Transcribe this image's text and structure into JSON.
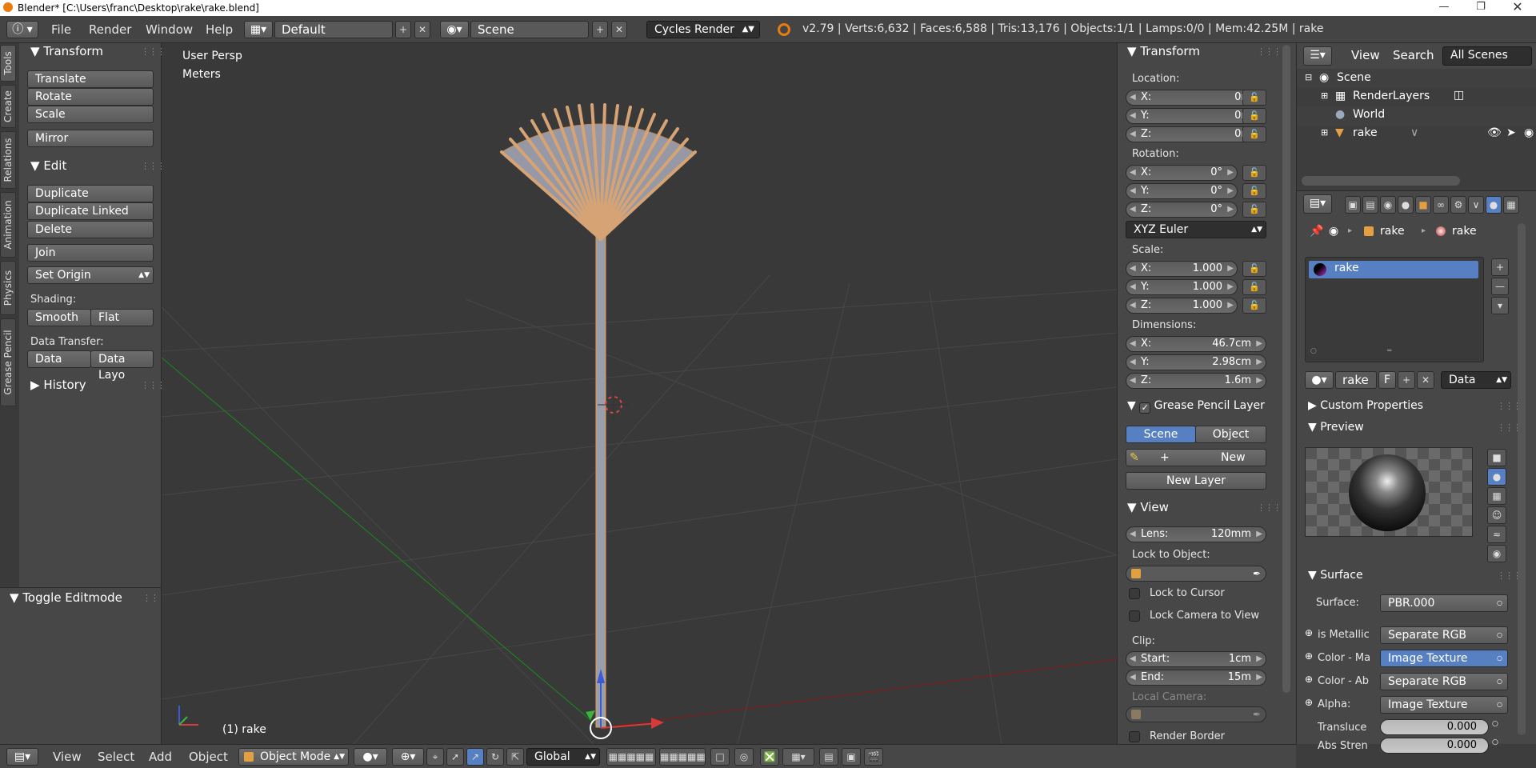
{
  "titlebar": {
    "title": "Blender* [C:\\Users\\franc\\Desktop\\rake\\rake.blend]"
  },
  "info": {
    "menus": [
      "File",
      "Render",
      "Window",
      "Help"
    ],
    "layout": "Default",
    "scene": "Scene",
    "engine": "Cycles Render",
    "stats": "v2.79 | Verts:6,632 | Faces:6,588 | Tris:13,176 | Objects:1/1 | Lamps:0/0 | Mem:42.25M | rake"
  },
  "tool_tabs": [
    "Tools",
    "Create",
    "Relations",
    "Animation",
    "Physics",
    "Grease Pencil"
  ],
  "tools": {
    "transform_header": "Transform",
    "translate": "Translate",
    "rotate": "Rotate",
    "scale": "Scale",
    "mirror": "Mirror",
    "edit_header": "Edit",
    "duplicate": "Duplicate",
    "duplicate_linked": "Duplicate Linked",
    "delete": "Delete",
    "join": "Join",
    "set_origin": "Set Origin",
    "shading_label": "Shading:",
    "smooth": "Smooth",
    "flat": "Flat",
    "data_transfer_label": "Data Transfer:",
    "data": "Data",
    "data_layo": "Data Layo",
    "history_header": "History",
    "toggle_editmode": "Toggle Editmode"
  },
  "viewport": {
    "view_name": "User Persp",
    "units": "Meters",
    "object_label": "(1) rake"
  },
  "properties": {
    "transform_header": "Transform",
    "location_label": "Location:",
    "location": [
      {
        "k": "X:",
        "v": "0m"
      },
      {
        "k": "Y:",
        "v": "0m"
      },
      {
        "k": "Z:",
        "v": "0m"
      }
    ],
    "rotation_label": "Rotation:",
    "rotation": [
      {
        "k": "X:",
        "v": "0°"
      },
      {
        "k": "Y:",
        "v": "0°"
      },
      {
        "k": "Z:",
        "v": "0°"
      }
    ],
    "rotation_mode": "XYZ Euler",
    "scale_label": "Scale:",
    "scale": [
      {
        "k": "X:",
        "v": "1.000"
      },
      {
        "k": "Y:",
        "v": "1.000"
      },
      {
        "k": "Z:",
        "v": "1.000"
      }
    ],
    "dimensions_label": "Dimensions:",
    "dimensions": [
      {
        "k": "X:",
        "v": "46.7cm"
      },
      {
        "k": "Y:",
        "v": "2.98cm"
      },
      {
        "k": "Z:",
        "v": "1.6m"
      }
    ],
    "gp_header": "Grease Pencil Layer",
    "gp_scene": "Scene",
    "gp_object": "Object",
    "gp_new": "New",
    "gp_new_layer": "New Layer",
    "view_header": "View",
    "lens_label": "Lens:",
    "lens_value": "120mm",
    "lock_to_object_label": "Lock to Object:",
    "lock_to_cursor": "Lock to Cursor",
    "lock_camera_to_view": "Lock Camera to View",
    "clip_label": "Clip:",
    "clip_start_label": "Start:",
    "clip_start": "1cm",
    "clip_end_label": "End:",
    "clip_end": "15m",
    "local_camera_label": "Local Camera:",
    "render_border": "Render Border"
  },
  "outliner": {
    "view": "View",
    "search": "Search",
    "filter": "All Scenes",
    "items": [
      "Scene",
      "RenderLayers",
      "World",
      "rake"
    ]
  },
  "material": {
    "breadcrumb_obj": "rake",
    "breadcrumb_mat": "rake",
    "slot": "rake",
    "mat_name": "rake",
    "fake_user": "F",
    "link_mode": "Data",
    "custom_props": "Custom Properties",
    "preview": "Preview",
    "surface_header": "Surface",
    "surface_label": "Surface:",
    "surface_value": "PBR.000",
    "inputs": [
      {
        "label": "is Metallic",
        "value": "Separate RGB"
      },
      {
        "label": "Color - Ma",
        "value": "Image Texture"
      },
      {
        "label": "Color - Ab",
        "value": "Separate RGB"
      },
      {
        "label": "Alpha:",
        "value": "Image Texture"
      }
    ],
    "translucency_label": "Transluce",
    "translucency_value": "0.000",
    "abs_strength_label": "Abs Stren",
    "abs_strength_value": "0.000"
  },
  "footer": {
    "menus": [
      "View",
      "Select",
      "Add",
      "Object"
    ],
    "mode": "Object Mode",
    "orientation": "Global"
  }
}
